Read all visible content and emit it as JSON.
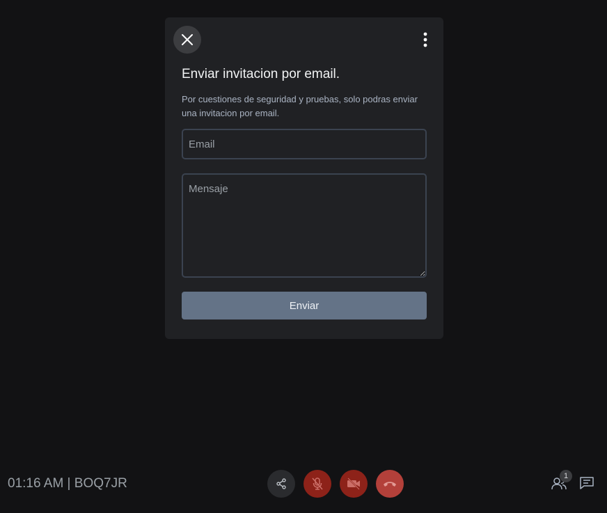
{
  "modal": {
    "title": "Enviar invitacion por email.",
    "description": "Por cuestiones de seguridad y pruebas, solo podras enviar una invitacion por email.",
    "email_placeholder": "Email",
    "email_value": "",
    "message_placeholder": "Mensaje",
    "message_value": "",
    "send_label": "Enviar"
  },
  "footer": {
    "meeting_info": "01:16 AM | BOQ7JR",
    "participants_count": "1"
  },
  "icons": {
    "close": "close-icon",
    "more": "more-vertical-icon",
    "share": "share-icon",
    "mic": "mic-off-icon",
    "camera": "video-off-icon",
    "end_call": "phone-hangup-icon",
    "participants": "people-icon",
    "chat": "chat-icon"
  },
  "colors": {
    "background": "#121214",
    "modal": "#202124",
    "send_button": "#647387",
    "muted_red": "#8d2219",
    "end_call_red": "#b3403a"
  }
}
